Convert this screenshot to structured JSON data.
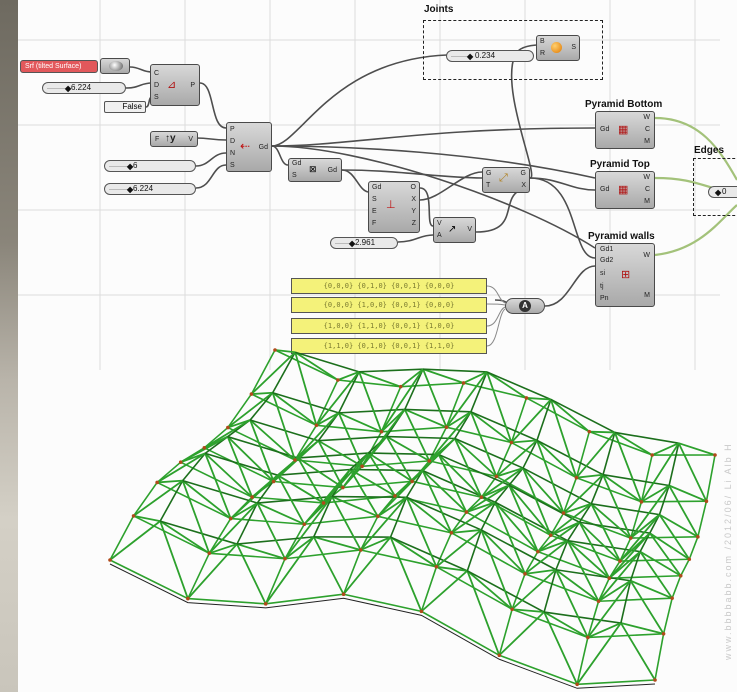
{
  "groups": {
    "joints": "Joints",
    "pyramid_bottom": "Pyramid Bottom",
    "pyramid_top": "Pyramid Top",
    "pyramid_walls": "Pyramid walls",
    "edges": "Edges"
  },
  "sliders": {
    "s1": "6.224",
    "s2": "6",
    "s3": "6.224",
    "s4": "2.961",
    "joints": "0.234",
    "edges": "0"
  },
  "toggle": "False",
  "panels": [
    "{0,0,0} {0,1,0} {0,0,1} {0,0,0}",
    "{0,0,0} {1,0,0} {0,0,1} {0,0,0}",
    "{1,0,0} {1,1,0} {0,0,1} {1,0,0}",
    "{1,1,0} {0,1,0} {0,0,1} {1,1,0}"
  ],
  "port_labels": {
    "rect_in": [
      "C",
      "D",
      "S"
    ],
    "rect_out": "P",
    "extr_in": [
      "F"
    ],
    "extr_out": "V",
    "grid_in": [
      "P",
      "D",
      "N",
      "S"
    ],
    "grid_out": "Gd",
    "gd_s": [
      "Gd",
      "S"
    ],
    "gd_out": "Gd",
    "cell_in": [
      "Gd",
      "S",
      "E",
      "F"
    ],
    "cell_out": [
      "O",
      "X",
      "Y",
      "Z"
    ],
    "va_in": [
      "V",
      "A"
    ],
    "va_out": "V",
    "gtx_in": [
      "G",
      "T"
    ],
    "gtx_out": [
      "G",
      "X"
    ],
    "sphere_in": [
      "B",
      "R"
    ],
    "sphere_out": "S",
    "pb_in": "Gd",
    "pb_out": [
      "W",
      "C",
      "M"
    ],
    "pt_in": "Gd",
    "pt_out": [
      "W",
      "C",
      "M"
    ],
    "pw_in": [
      "Gd1",
      "Gd2",
      "si",
      "tj",
      "Pn"
    ],
    "pw_out": [
      "W",
      "M"
    ],
    "merge": "A"
  },
  "side_text": "www.bbbbabb.com  /2012/06/  Li  Alb  H",
  "colors": {
    "wire": "#4e4e4e",
    "wire_green": "#a3c27a",
    "truss": "#2da12d",
    "truss_dark": "#1c6f1c",
    "node_point": "#b04a1a",
    "panel": "#f4f27a",
    "red_param": "#e2585b"
  },
  "red_param_text": "Srf  (tilted Surface)"
}
